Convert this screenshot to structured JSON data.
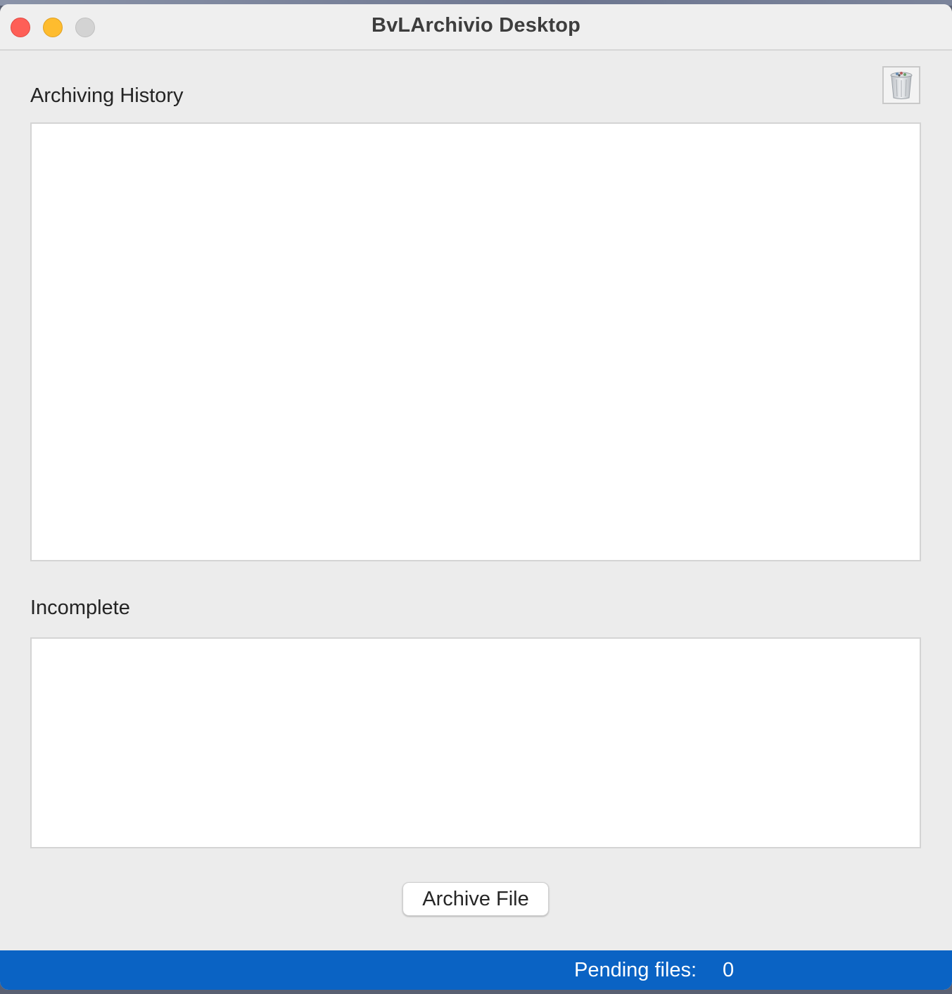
{
  "window": {
    "title": "BvLArchivio Desktop"
  },
  "toolbar": {
    "trash_icon": "trash-can-icon"
  },
  "sections": {
    "history": {
      "label": "Archiving History",
      "items": []
    },
    "incomplete": {
      "label": "Incomplete",
      "items": []
    }
  },
  "actions": {
    "archive_label": "Archive File"
  },
  "status": {
    "pending_label": "Pending files:",
    "pending_count": "0"
  },
  "colors": {
    "status_bar": "#0a63c4",
    "close": "#fe5f57",
    "minimize": "#febc2e",
    "zoom_disabled": "#d3d3d3"
  }
}
